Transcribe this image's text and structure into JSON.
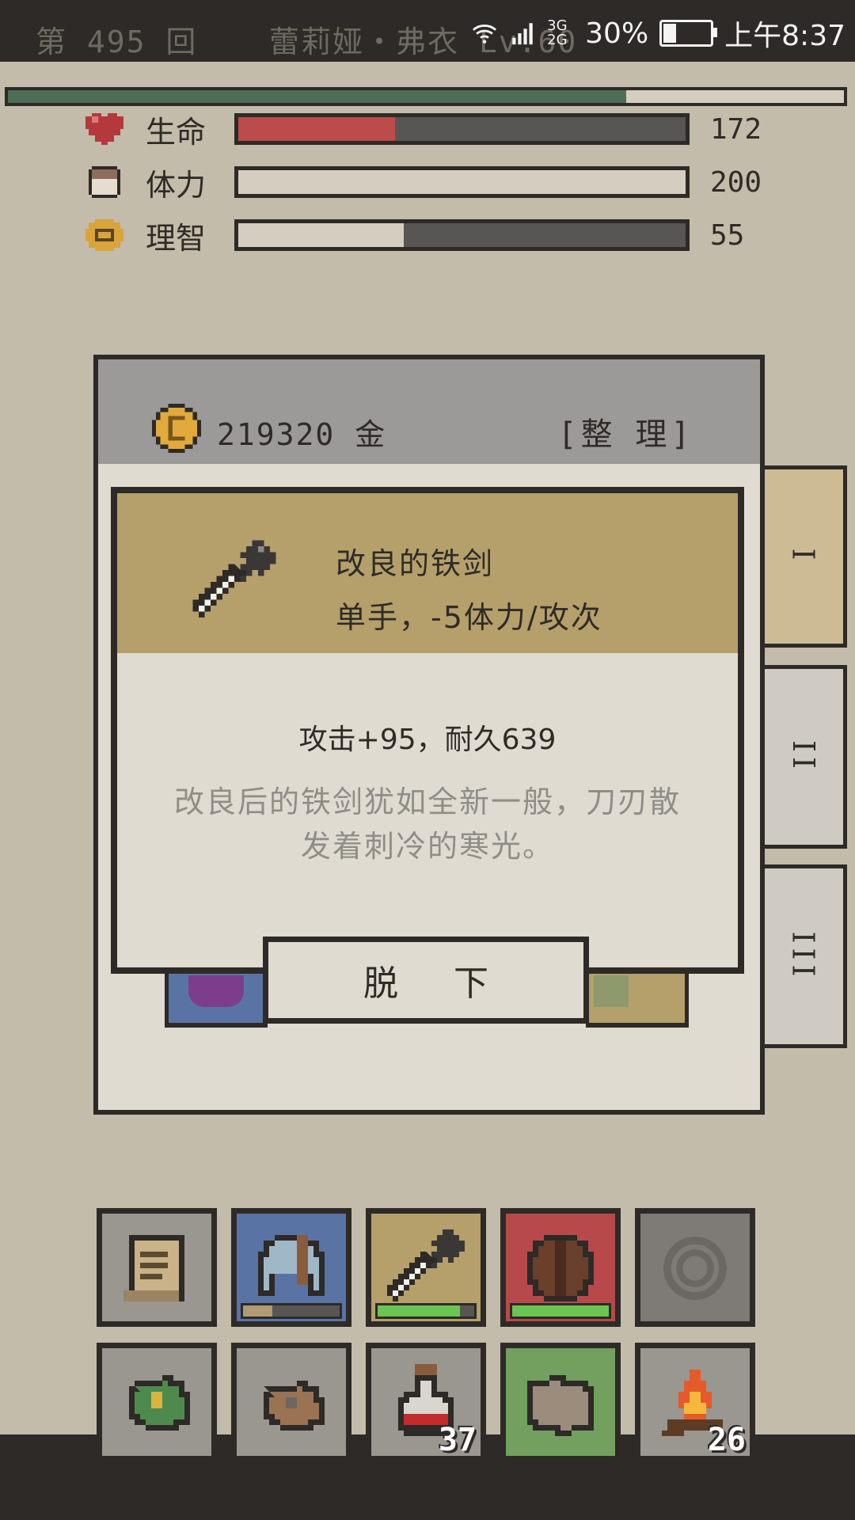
{
  "status": {
    "round_label": "第 495 回",
    "character": "蕾莉娅・弗衣 Lv.60",
    "battery": "30%",
    "battery_level": 0.3,
    "time": "上午8:37",
    "network": "3G 2G"
  },
  "xp": {
    "level": 0.74,
    "color": "#4e6e57"
  },
  "stats": [
    {
      "label": "生命",
      "value": "172",
      "fill": 0.35,
      "color": "#bc4b4c",
      "icon": "heart-icon"
    },
    {
      "label": "体力",
      "value": "200",
      "fill": 1.0,
      "color": "#d5cec0",
      "icon": "stamina-icon"
    },
    {
      "label": "理智",
      "value": "55",
      "fill": 0.37,
      "color": "#d5cec0",
      "icon": "sanity-icon"
    }
  ],
  "inventory": {
    "gold": "219320 金",
    "sort_label": "[整 理]",
    "tabs": [
      "I",
      "II",
      "III"
    ],
    "active_tab": 0
  },
  "item": {
    "name": "改良的铁剑",
    "type": "单手，-5体力/攻次",
    "stats": "攻击+95，耐久639",
    "description": "改良后的铁剑犹如全新一般，刀刃散发着刺冷的寒光。",
    "icon": "sword-icon"
  },
  "unequip_label": "脱 下",
  "hotbar_top": [
    {
      "icon": "scroll-icon",
      "bg": "#9a9791"
    },
    {
      "icon": "helmet-icon",
      "bg": "#5a73a5",
      "gauge": 0.3,
      "gauge_color": "#b09a74"
    },
    {
      "icon": "sword-icon",
      "bg": "#b5a06b",
      "gauge": 0.85,
      "gauge_color": "#6bc552"
    },
    {
      "icon": "shield-icon",
      "bg": "#b8494a",
      "gauge": 1.0,
      "gauge_color": "#6bc552"
    },
    {
      "icon": "empty-ring-icon",
      "bg": "#7e7b77"
    }
  ],
  "hotbar_bottom": [
    {
      "icon": "spellbook-icon",
      "bg": "#9a9791"
    },
    {
      "icon": "journal-icon",
      "bg": "#9a9791"
    },
    {
      "icon": "potion-icon",
      "bg": "#9a9791",
      "count": "37"
    },
    {
      "icon": "map-icon",
      "bg": "#73a05e"
    },
    {
      "icon": "campfire-icon",
      "bg": "#9a9791",
      "count": "26"
    }
  ]
}
